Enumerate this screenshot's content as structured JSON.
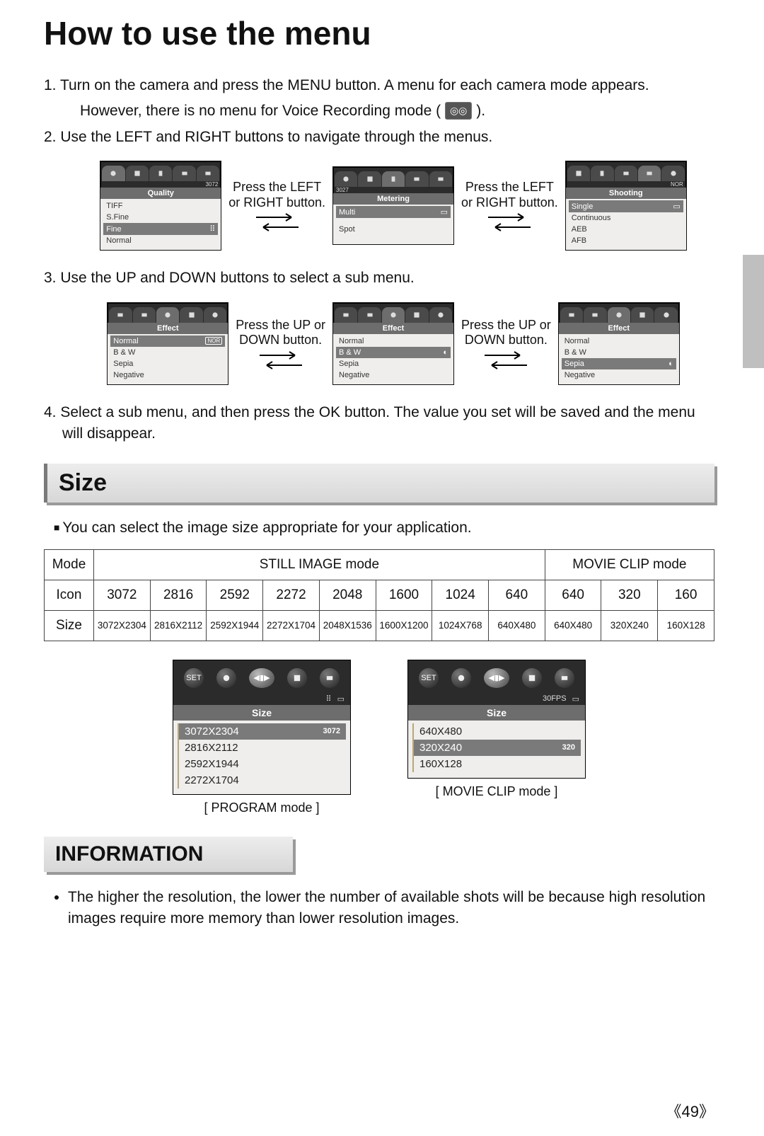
{
  "title": "How to use the menu",
  "steps": {
    "s1a": "1. Turn on the camera and press the MENU button. A menu for each camera mode appears.",
    "s1b": "However, there is no menu for Voice Recording mode (",
    "s1c": ").",
    "s2": "2. Use the LEFT and RIGHT buttons to navigate through the menus.",
    "s3": "3. Use the UP and DOWN buttons to select a sub menu.",
    "s4": "4. Select a sub menu, and then press the OK button. The value you set will be saved and the menu will disappear."
  },
  "press_lr": "Press the LEFT\nor RIGHT button.",
  "press_ud": "Press the UP or\nDOWN button.",
  "row1": {
    "a": {
      "title": "Quality",
      "tag": "3072",
      "items": [
        "TIFF",
        "S.Fine",
        "Fine",
        "Normal"
      ],
      "sel": 2
    },
    "b": {
      "title": "Metering",
      "tag": "3027",
      "items": [
        "Multi",
        "Spot"
      ],
      "sel": 0
    },
    "c": {
      "title": "Shooting",
      "tag": "NOR",
      "items": [
        "Single",
        "Continuous",
        "AEB",
        "AFB"
      ],
      "sel": 0
    }
  },
  "row2": {
    "a": {
      "title": "Effect",
      "items": [
        "Normal",
        "B & W",
        "Sepia",
        "Negative"
      ],
      "sel": 0,
      "badge": "NOR"
    },
    "b": {
      "title": "Effect",
      "items": [
        "Normal",
        "B & W",
        "Sepia",
        "Negative"
      ],
      "sel": 1,
      "badge": ""
    },
    "c": {
      "title": "Effect",
      "items": [
        "Normal",
        "B & W",
        "Sepia",
        "Negative"
      ],
      "sel": 2,
      "badge": ""
    }
  },
  "size": {
    "heading": "Size",
    "blurb": "You can select the image size appropriate for your application.",
    "table": {
      "rows": [
        "Mode",
        "Icon",
        "Size"
      ],
      "still_header": "STILL IMAGE mode",
      "movie_header": "MOVIE CLIP mode",
      "icons": [
        "3072",
        "2816",
        "2592",
        "2272",
        "2048",
        "1600",
        "1024",
        "640",
        "640",
        "320",
        "160"
      ],
      "sizes": [
        "3072X2304",
        "2816X2112",
        "2592X1944",
        "2272X1704",
        "2048X1536",
        "1600X1200",
        "1024X768",
        "640X480",
        "640X480",
        "320X240",
        "160X128"
      ]
    }
  },
  "big": {
    "program": {
      "title": "Size",
      "set": "SET",
      "lines": [
        "3072X2304",
        "2816X2112",
        "2592X1944",
        "2272X1704"
      ],
      "sel": 0,
      "tag": "3072",
      "caption": "[ PROGRAM mode ]"
    },
    "movie": {
      "title": "Size",
      "set": "SET",
      "sub": "30FPS",
      "lines": [
        "640X480",
        "320X240",
        "160X128"
      ],
      "sel": 1,
      "tag": "320",
      "caption": "[ MOVIE CLIP mode ]"
    }
  },
  "info": {
    "heading": "INFORMATION",
    "bullet": "The higher the resolution, the lower the number of available shots will be because high resolution images require more memory than lower resolution images."
  },
  "page_num": "49"
}
